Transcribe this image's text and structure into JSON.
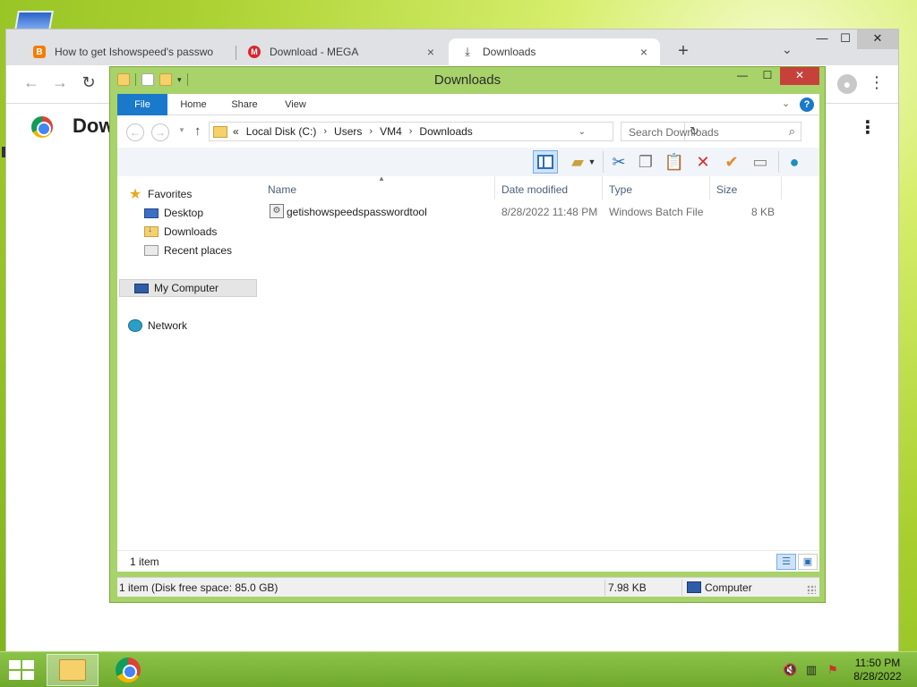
{
  "browser": {
    "tabs": [
      {
        "label": "How to get Ishowspeed's passwo",
        "icon": "blogger-icon",
        "active": false
      },
      {
        "label": "Download - MEGA",
        "icon": "mega-icon",
        "active": false
      },
      {
        "label": "Downloads",
        "icon": "download-icon",
        "active": true
      }
    ],
    "tab_close_glyph": "×",
    "new_tab_glyph": "+",
    "page_title": "Dow"
  },
  "explorer": {
    "title": "Downloads",
    "ribbon_tabs": [
      "File",
      "Home",
      "Share",
      "View"
    ],
    "breadcrumb": {
      "prefix": "«",
      "items": [
        "Local Disk (C:)",
        "Users",
        "VM4",
        "Downloads"
      ]
    },
    "search_placeholder": "Search Downloads",
    "nav": {
      "favorites": "Favorites",
      "desktop": "Desktop",
      "downloads": "Downloads",
      "recent": "Recent places",
      "computer": "My Computer",
      "network": "Network"
    },
    "columns": {
      "name": "Name",
      "date": "Date modified",
      "type": "Type",
      "size": "Size"
    },
    "files": [
      {
        "name": "getishowspeedspasswordtool",
        "date": "8/28/2022 11:48 PM",
        "type": "Windows Batch File",
        "size": "8 KB"
      }
    ],
    "item_count": "1 item",
    "status": {
      "left": "1 item (Disk free space: 85.0 GB)",
      "size": "7.98 KB",
      "location": "Computer"
    }
  },
  "taskbar": {
    "time": "11:50 PM",
    "date": "8/28/2022"
  },
  "colors": {
    "desktop_green": "#a8cf2e",
    "explorer_frame": "#a8d26a",
    "ribbon_file_blue": "#1979ca",
    "explorer_close_red": "#c7413b"
  }
}
